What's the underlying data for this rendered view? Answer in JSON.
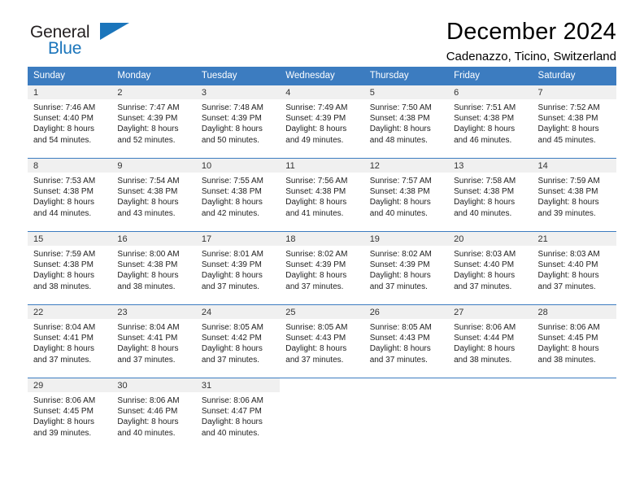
{
  "logo": {
    "word_one": "General",
    "word_two": "Blue",
    "triangle": "triangle-icon",
    "brand_color": "#1b75bb",
    "text_color": "#231f20"
  },
  "header": {
    "title": "December 2024",
    "subtitle": "Cadenazzo, Ticino, Switzerland"
  },
  "calendar": {
    "header_background": "#3c7cc0",
    "header_text_color": "#ffffff",
    "daynum_background": "#f0f0f0",
    "weekdays": [
      "Sunday",
      "Monday",
      "Tuesday",
      "Wednesday",
      "Thursday",
      "Friday",
      "Saturday"
    ],
    "weeks": [
      [
        {
          "day": "1",
          "sunrise": "Sunrise: 7:46 AM",
          "sunset": "Sunset: 4:40 PM",
          "daylight_line1": "Daylight: 8 hours",
          "daylight_line2": "and 54 minutes."
        },
        {
          "day": "2",
          "sunrise": "Sunrise: 7:47 AM",
          "sunset": "Sunset: 4:39 PM",
          "daylight_line1": "Daylight: 8 hours",
          "daylight_line2": "and 52 minutes."
        },
        {
          "day": "3",
          "sunrise": "Sunrise: 7:48 AM",
          "sunset": "Sunset: 4:39 PM",
          "daylight_line1": "Daylight: 8 hours",
          "daylight_line2": "and 50 minutes."
        },
        {
          "day": "4",
          "sunrise": "Sunrise: 7:49 AM",
          "sunset": "Sunset: 4:39 PM",
          "daylight_line1": "Daylight: 8 hours",
          "daylight_line2": "and 49 minutes."
        },
        {
          "day": "5",
          "sunrise": "Sunrise: 7:50 AM",
          "sunset": "Sunset: 4:38 PM",
          "daylight_line1": "Daylight: 8 hours",
          "daylight_line2": "and 48 minutes."
        },
        {
          "day": "6",
          "sunrise": "Sunrise: 7:51 AM",
          "sunset": "Sunset: 4:38 PM",
          "daylight_line1": "Daylight: 8 hours",
          "daylight_line2": "and 46 minutes."
        },
        {
          "day": "7",
          "sunrise": "Sunrise: 7:52 AM",
          "sunset": "Sunset: 4:38 PM",
          "daylight_line1": "Daylight: 8 hours",
          "daylight_line2": "and 45 minutes."
        }
      ],
      [
        {
          "day": "8",
          "sunrise": "Sunrise: 7:53 AM",
          "sunset": "Sunset: 4:38 PM",
          "daylight_line1": "Daylight: 8 hours",
          "daylight_line2": "and 44 minutes."
        },
        {
          "day": "9",
          "sunrise": "Sunrise: 7:54 AM",
          "sunset": "Sunset: 4:38 PM",
          "daylight_line1": "Daylight: 8 hours",
          "daylight_line2": "and 43 minutes."
        },
        {
          "day": "10",
          "sunrise": "Sunrise: 7:55 AM",
          "sunset": "Sunset: 4:38 PM",
          "daylight_line1": "Daylight: 8 hours",
          "daylight_line2": "and 42 minutes."
        },
        {
          "day": "11",
          "sunrise": "Sunrise: 7:56 AM",
          "sunset": "Sunset: 4:38 PM",
          "daylight_line1": "Daylight: 8 hours",
          "daylight_line2": "and 41 minutes."
        },
        {
          "day": "12",
          "sunrise": "Sunrise: 7:57 AM",
          "sunset": "Sunset: 4:38 PM",
          "daylight_line1": "Daylight: 8 hours",
          "daylight_line2": "and 40 minutes."
        },
        {
          "day": "13",
          "sunrise": "Sunrise: 7:58 AM",
          "sunset": "Sunset: 4:38 PM",
          "daylight_line1": "Daylight: 8 hours",
          "daylight_line2": "and 40 minutes."
        },
        {
          "day": "14",
          "sunrise": "Sunrise: 7:59 AM",
          "sunset": "Sunset: 4:38 PM",
          "daylight_line1": "Daylight: 8 hours",
          "daylight_line2": "and 39 minutes."
        }
      ],
      [
        {
          "day": "15",
          "sunrise": "Sunrise: 7:59 AM",
          "sunset": "Sunset: 4:38 PM",
          "daylight_line1": "Daylight: 8 hours",
          "daylight_line2": "and 38 minutes."
        },
        {
          "day": "16",
          "sunrise": "Sunrise: 8:00 AM",
          "sunset": "Sunset: 4:38 PM",
          "daylight_line1": "Daylight: 8 hours",
          "daylight_line2": "and 38 minutes."
        },
        {
          "day": "17",
          "sunrise": "Sunrise: 8:01 AM",
          "sunset": "Sunset: 4:39 PM",
          "daylight_line1": "Daylight: 8 hours",
          "daylight_line2": "and 37 minutes."
        },
        {
          "day": "18",
          "sunrise": "Sunrise: 8:02 AM",
          "sunset": "Sunset: 4:39 PM",
          "daylight_line1": "Daylight: 8 hours",
          "daylight_line2": "and 37 minutes."
        },
        {
          "day": "19",
          "sunrise": "Sunrise: 8:02 AM",
          "sunset": "Sunset: 4:39 PM",
          "daylight_line1": "Daylight: 8 hours",
          "daylight_line2": "and 37 minutes."
        },
        {
          "day": "20",
          "sunrise": "Sunrise: 8:03 AM",
          "sunset": "Sunset: 4:40 PM",
          "daylight_line1": "Daylight: 8 hours",
          "daylight_line2": "and 37 minutes."
        },
        {
          "day": "21",
          "sunrise": "Sunrise: 8:03 AM",
          "sunset": "Sunset: 4:40 PM",
          "daylight_line1": "Daylight: 8 hours",
          "daylight_line2": "and 37 minutes."
        }
      ],
      [
        {
          "day": "22",
          "sunrise": "Sunrise: 8:04 AM",
          "sunset": "Sunset: 4:41 PM",
          "daylight_line1": "Daylight: 8 hours",
          "daylight_line2": "and 37 minutes."
        },
        {
          "day": "23",
          "sunrise": "Sunrise: 8:04 AM",
          "sunset": "Sunset: 4:41 PM",
          "daylight_line1": "Daylight: 8 hours",
          "daylight_line2": "and 37 minutes."
        },
        {
          "day": "24",
          "sunrise": "Sunrise: 8:05 AM",
          "sunset": "Sunset: 4:42 PM",
          "daylight_line1": "Daylight: 8 hours",
          "daylight_line2": "and 37 minutes."
        },
        {
          "day": "25",
          "sunrise": "Sunrise: 8:05 AM",
          "sunset": "Sunset: 4:43 PM",
          "daylight_line1": "Daylight: 8 hours",
          "daylight_line2": "and 37 minutes."
        },
        {
          "day": "26",
          "sunrise": "Sunrise: 8:05 AM",
          "sunset": "Sunset: 4:43 PM",
          "daylight_line1": "Daylight: 8 hours",
          "daylight_line2": "and 37 minutes."
        },
        {
          "day": "27",
          "sunrise": "Sunrise: 8:06 AM",
          "sunset": "Sunset: 4:44 PM",
          "daylight_line1": "Daylight: 8 hours",
          "daylight_line2": "and 38 minutes."
        },
        {
          "day": "28",
          "sunrise": "Sunrise: 8:06 AM",
          "sunset": "Sunset: 4:45 PM",
          "daylight_line1": "Daylight: 8 hours",
          "daylight_line2": "and 38 minutes."
        }
      ],
      [
        {
          "day": "29",
          "sunrise": "Sunrise: 8:06 AM",
          "sunset": "Sunset: 4:45 PM",
          "daylight_line1": "Daylight: 8 hours",
          "daylight_line2": "and 39 minutes."
        },
        {
          "day": "30",
          "sunrise": "Sunrise: 8:06 AM",
          "sunset": "Sunset: 4:46 PM",
          "daylight_line1": "Daylight: 8 hours",
          "daylight_line2": "and 40 minutes."
        },
        {
          "day": "31",
          "sunrise": "Sunrise: 8:06 AM",
          "sunset": "Sunset: 4:47 PM",
          "daylight_line1": "Daylight: 8 hours",
          "daylight_line2": "and 40 minutes."
        },
        {
          "day": "",
          "sunrise": "",
          "sunset": "",
          "daylight_line1": "",
          "daylight_line2": ""
        },
        {
          "day": "",
          "sunrise": "",
          "sunset": "",
          "daylight_line1": "",
          "daylight_line2": ""
        },
        {
          "day": "",
          "sunrise": "",
          "sunset": "",
          "daylight_line1": "",
          "daylight_line2": ""
        },
        {
          "day": "",
          "sunrise": "",
          "sunset": "",
          "daylight_line1": "",
          "daylight_line2": ""
        }
      ]
    ]
  }
}
